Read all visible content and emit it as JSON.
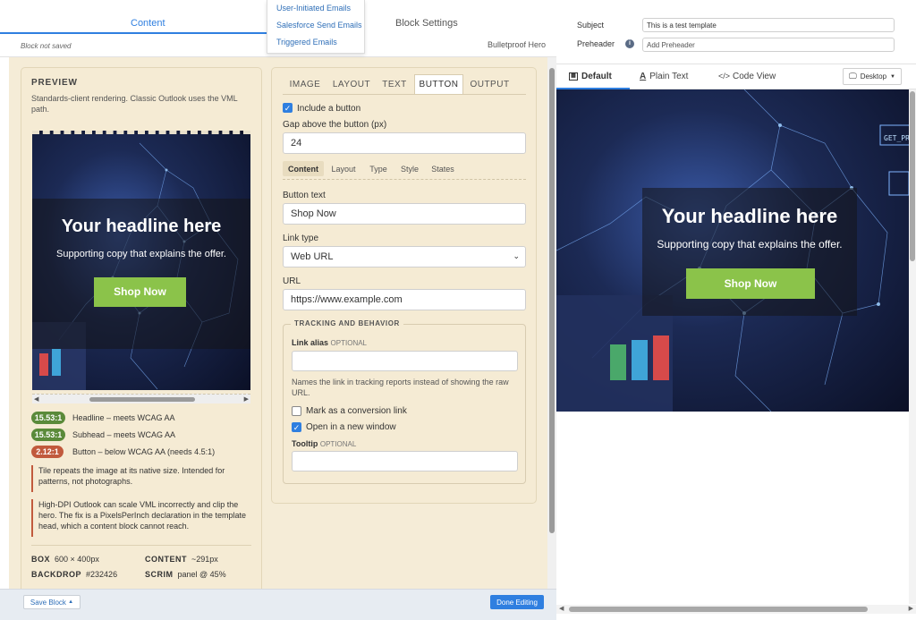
{
  "left_header": {
    "content_tab": "Content",
    "block_settings_tab": "Block Settings",
    "status": "Block not saved",
    "block_name": "Bulletproof Hero"
  },
  "dropdown": {
    "items": [
      "User-Initiated Emails",
      "Salesforce Send Emails",
      "Triggered Emails"
    ]
  },
  "preview": {
    "title": "PREVIEW",
    "description": "Standards-client rendering. Classic Outlook uses the VML path.",
    "headline": "Your headline here",
    "subhead": "Supporting copy that explains the offer.",
    "button": "Shop Now",
    "contrast": [
      {
        "ratio": "15.53:1",
        "text": "Headline – meets WCAG AA",
        "color": "#5a8a3a"
      },
      {
        "ratio": "15.53:1",
        "text": "Subhead – meets WCAG AA",
        "color": "#5a8a3a"
      },
      {
        "ratio": "2.12:1",
        "text": "Button – below WCAG AA (needs 4.5:1)",
        "color": "#c15a3d"
      }
    ],
    "notes": [
      "Tile repeats the image at its native size. Intended for patterns, not photographs.",
      "High-DPI Outlook can scale VML incorrectly and clip the hero. The fix is a PixelsPerInch declaration in the template head, which a content block cannot reach."
    ],
    "specs": {
      "box_label": "BOX",
      "box_value": "600 × 400px",
      "content_label": "CONTENT",
      "content_value": "~291px",
      "backdrop_label": "BACKDROP",
      "backdrop_value": "#232426",
      "scrim_label": "SCRIM",
      "scrim_value": "panel @ 45%"
    }
  },
  "settings": {
    "tabs": [
      "IMAGE",
      "LAYOUT",
      "TEXT",
      "BUTTON",
      "OUTPUT"
    ],
    "include_button": "Include a button",
    "gap_label": "Gap above the button (px)",
    "gap_value": "24",
    "subtabs": [
      "Content",
      "Layout",
      "Type",
      "Style",
      "States"
    ],
    "button_text_label": "Button text",
    "button_text_value": "Shop Now",
    "link_type_label": "Link type",
    "link_type_value": "Web URL",
    "url_label": "URL",
    "url_value": "https://www.example.com",
    "tracking_title": "TRACKING AND BEHAVIOR",
    "link_alias_label": "Link alias",
    "optional": "OPTIONAL",
    "link_alias_help": "Names the link in tracking reports instead of showing the raw URL.",
    "conversion_label": "Mark as a conversion link",
    "new_window_label": "Open in a new window",
    "tooltip_label": "Tooltip"
  },
  "footer": {
    "save_block": "Save Block",
    "done": "Done Editing"
  },
  "right": {
    "subject_label": "Subject",
    "subject_value": "This is a test template",
    "preheader_label": "Preheader",
    "preheader_placeholder": "Add Preheader",
    "tabs": {
      "default": "Default",
      "plain": "Plain Text",
      "code": "Code View"
    },
    "device": "Desktop",
    "headline": "Your headline here",
    "subhead": "Supporting copy that explains the offer.",
    "button": "Shop Now",
    "hud_text": "GET_PRO"
  },
  "colors": {
    "accent": "#2f7fe0",
    "button_green": "#8bc34a",
    "fail": "#c15a3d",
    "pass": "#5a8a3a",
    "panel": "#f5ebd4"
  }
}
